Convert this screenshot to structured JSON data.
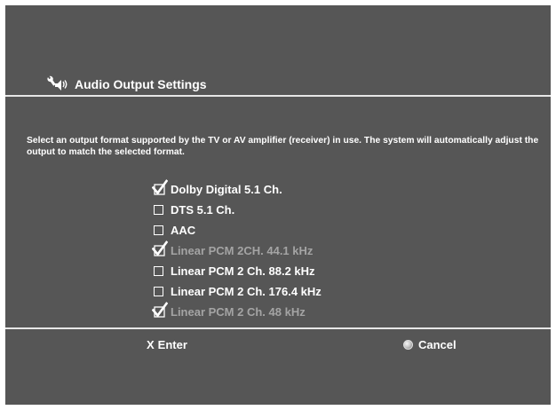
{
  "header": {
    "title": "Audio Output Settings",
    "icon": "audio-settings-icon"
  },
  "description": "Select an output format supported by the TV or AV amplifier (receiver) in use. The system will automatically adjust the output to match the selected format.",
  "options": [
    {
      "label": "Dolby Digital 5.1 Ch.",
      "checked": true,
      "enabled": true
    },
    {
      "label": "DTS 5.1 Ch.",
      "checked": false,
      "enabled": true
    },
    {
      "label": "AAC",
      "checked": false,
      "enabled": true
    },
    {
      "label": "Linear PCM 2CH. 44.1 kHz",
      "checked": true,
      "enabled": false
    },
    {
      "label": "Linear PCM 2 Ch. 88.2 kHz",
      "checked": false,
      "enabled": true
    },
    {
      "label": "Linear PCM 2 Ch. 176.4 kHz",
      "checked": false,
      "enabled": true
    },
    {
      "label": "Linear PCM 2 Ch. 48 kHz",
      "checked": true,
      "enabled": false
    }
  ],
  "footer": {
    "enter_glyph": "X",
    "enter_label": "Enter",
    "cancel_label": "Cancel",
    "cancel_icon": "circle-button-icon"
  },
  "colors": {
    "background": "#565656",
    "text": "#ffffff",
    "disabled_text": "#a4a4a4",
    "divider": "#e6e6e6"
  }
}
